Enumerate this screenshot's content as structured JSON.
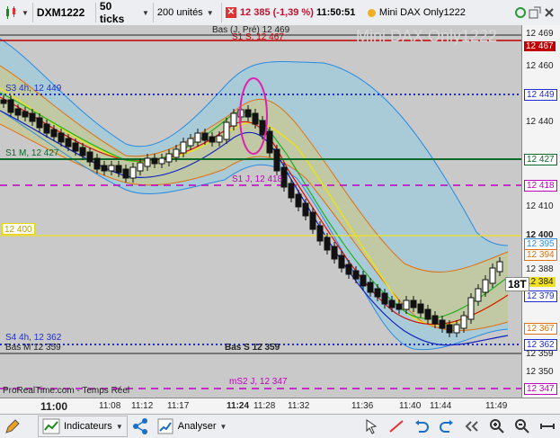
{
  "toolbar": {
    "instrument": "DXM1222",
    "interval": "50 ticks",
    "units": "200 unités",
    "last_price": "12 385",
    "change": "(-1,39 %)",
    "time": "11:50:51",
    "title": "Mini DAX Only1222"
  },
  "chart": {
    "watermark": "Mini DAX Only1222",
    "footer": "ProRealTime.com - Temps Réel",
    "lines": {
      "bas_j_pre": "Bas (J, Pré) 12 469",
      "s1_s": "S1 S, 12 467",
      "s3_4h": "S3 4h, 12 449",
      "s1_m": "S1 M, 12 427",
      "s1_j": "S1 J, 12 418",
      "s4_4h": "S4 4h, 12 362",
      "bas_m": "Bas M 12 359",
      "bas_s": "Bas S 12 359",
      "ms2_j": "mS2 J, 12 347",
      "yellow_level": "12 400"
    },
    "timeframe_badge": "18T"
  },
  "price_axis": {
    "ticks": [
      "12 469",
      "12 467",
      "12 460",
      "12 449",
      "12 440",
      "12 427",
      "12 418",
      "12 410",
      "12 400",
      "12 395",
      "12 394",
      "12 388",
      "12 384",
      "12 379",
      "12 367",
      "12 362",
      "12 359",
      "12 350",
      "12 347"
    ]
  },
  "time_axis": {
    "ticks": [
      "11:00",
      "11:08",
      "11:12",
      "11:17",
      "11:24",
      "11:28",
      "11:32",
      "11:36",
      "11:40",
      "11:44",
      "11:49"
    ]
  },
  "bottombar": {
    "indicators": "Indicateurs",
    "analyze": "Analyser"
  },
  "colors": {
    "accent_red": "#c8102e",
    "support_blue": "#1e2dd6",
    "support_magenta": "#c000c0",
    "support_green": "#0a6a2a",
    "bollinger_fill": "#a9cbd8"
  }
}
